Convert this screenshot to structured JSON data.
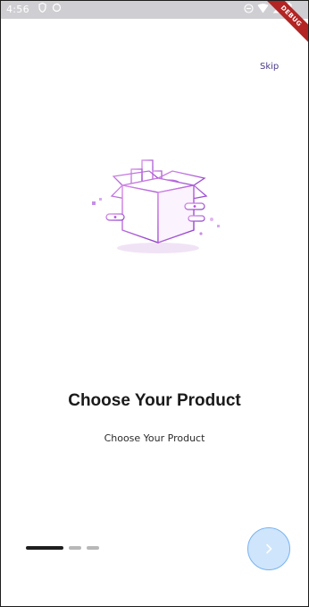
{
  "status_bar": {
    "time": "4:56",
    "left_icons": [
      "shield-icon",
      "sync-icon"
    ],
    "right_icons": [
      "dnd-icon",
      "wifi-icon",
      "signal-icon",
      "battery-icon"
    ],
    "debug_banner": "DEBUG"
  },
  "onboarding": {
    "skip_label": "Skip",
    "illustration_icon": "product-box-illustration",
    "title": "Choose Your Product",
    "subtitle": "Choose Your Product",
    "page_index": 1,
    "page_count": 3,
    "next_icon": "chevron-right-icon"
  },
  "colors": {
    "accent": "#78b3f1",
    "next_fill": "#cfe5fb",
    "illustration_primary": "#b64be0",
    "skip_text": "#4b3a8a"
  }
}
